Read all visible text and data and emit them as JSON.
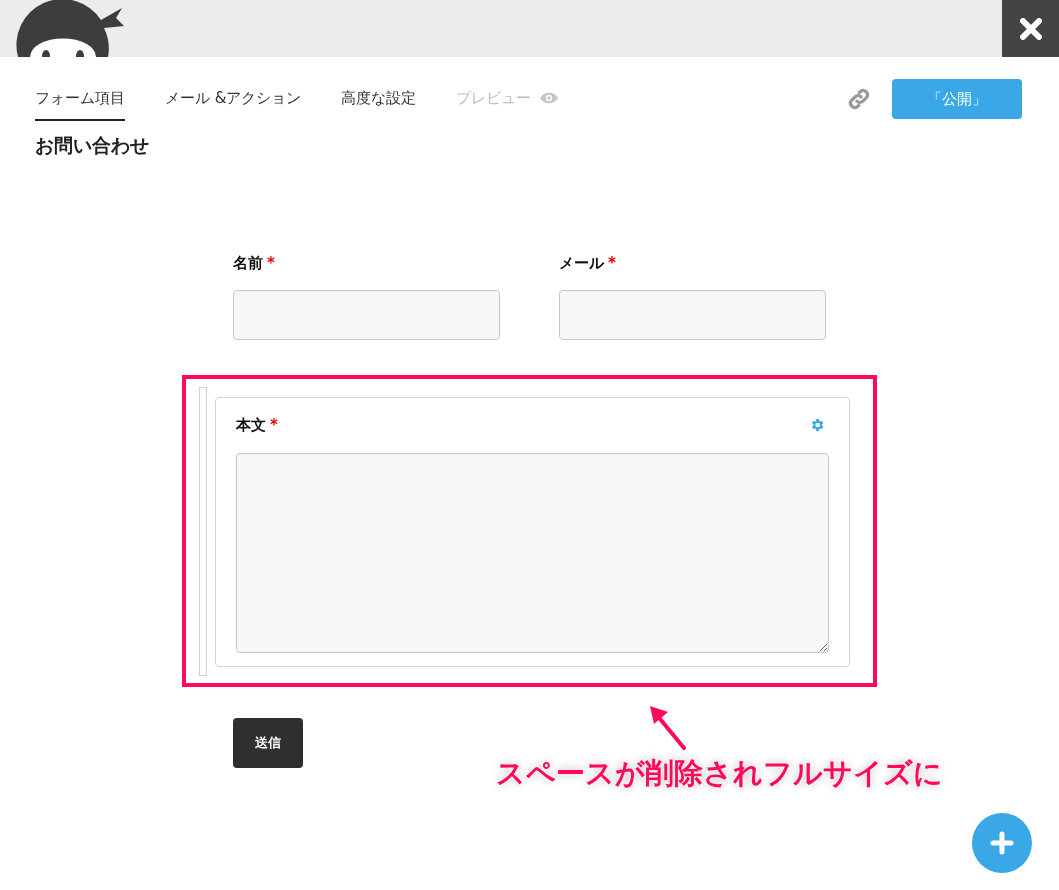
{
  "tabs": [
    {
      "label": "フォーム項目",
      "selected": true,
      "disabled": false
    },
    {
      "label": "メール &アクション",
      "selected": false,
      "disabled": false
    },
    {
      "label": "高度な設定",
      "selected": false,
      "disabled": false
    },
    {
      "label": "プレビュー",
      "selected": false,
      "disabled": true
    }
  ],
  "publish_button": "「公開」",
  "form_title": "お問い合わせ",
  "fields": [
    {
      "label": "名前",
      "required_mark": "*",
      "kind": "input"
    },
    {
      "label": "メール",
      "required_mark": "*",
      "kind": "input"
    },
    {
      "label": "本文",
      "required_mark": "*",
      "kind": "textarea"
    }
  ],
  "submit_button": "送信",
  "annotation": "スペースが削除されフルサイズに"
}
